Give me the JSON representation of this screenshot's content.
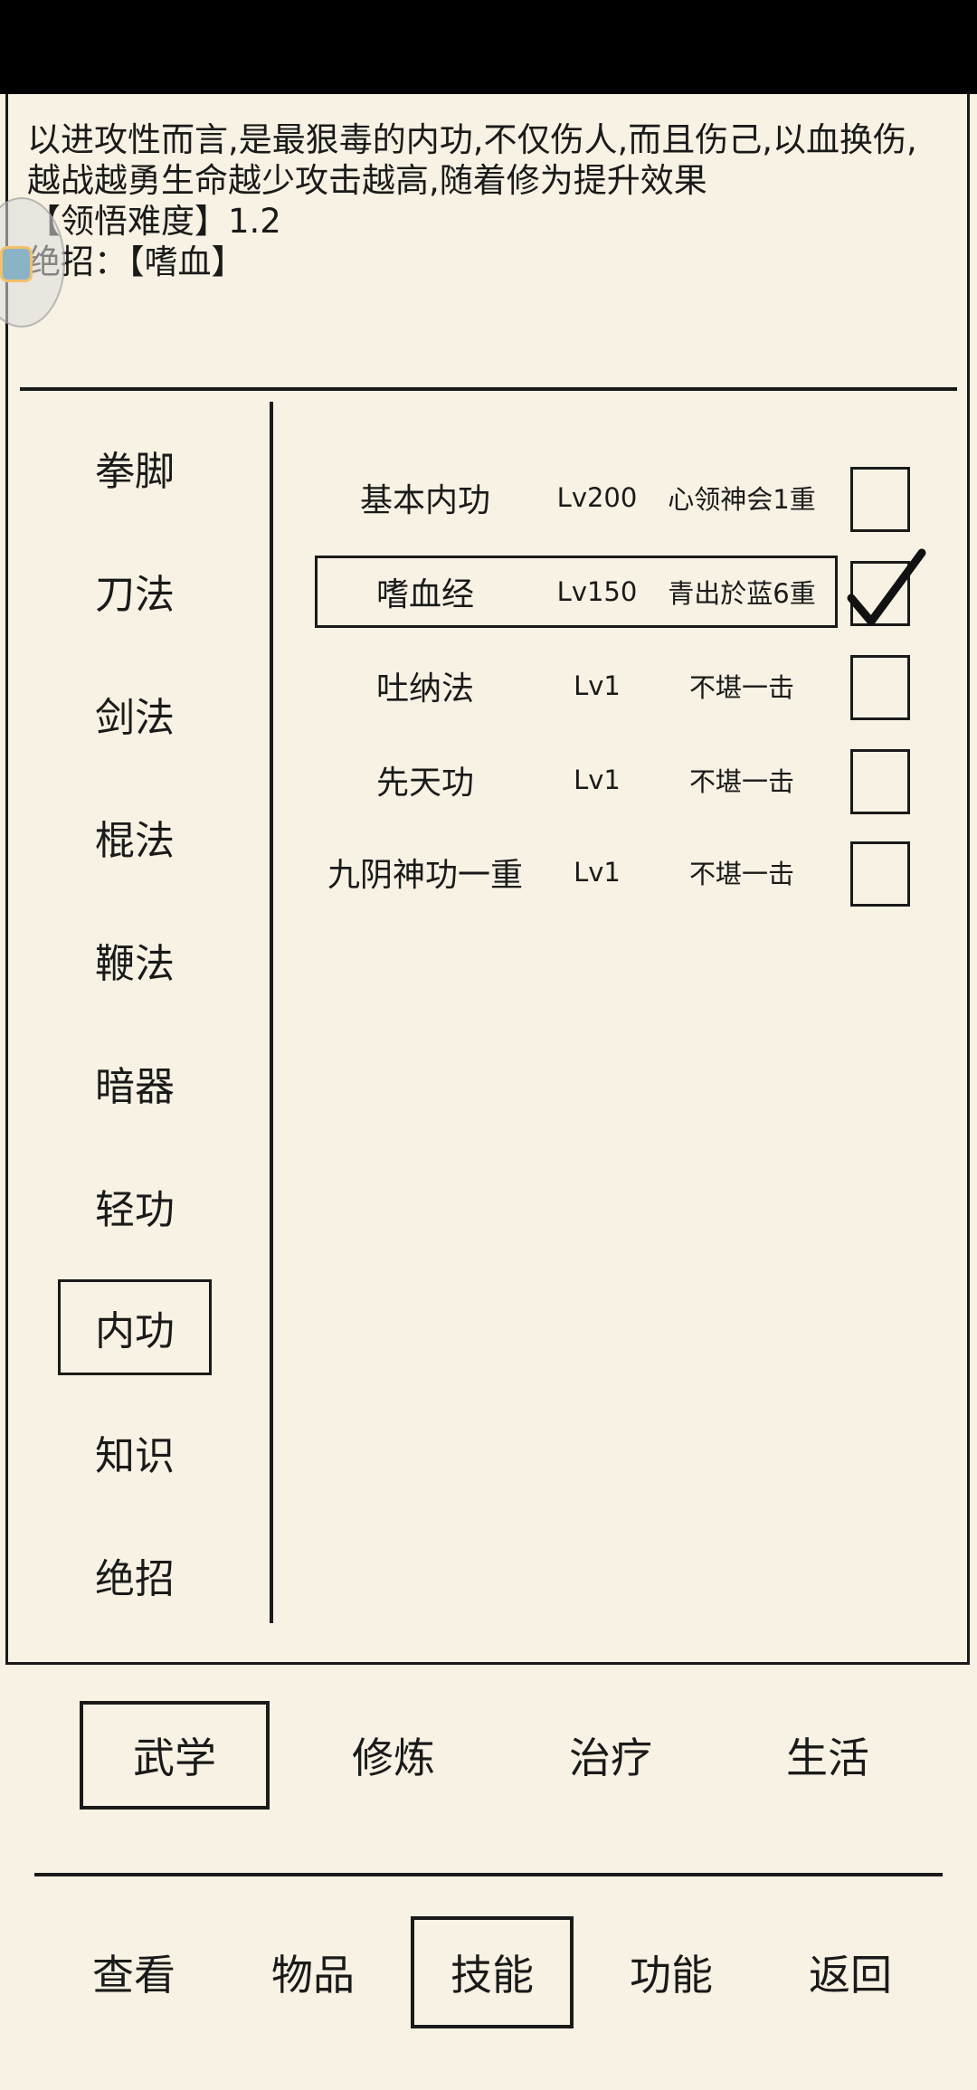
{
  "description": {
    "line1": "以进攻性而言,是最狠毒的内功,不仅伤人,而且伤己,以血换伤,",
    "line2": "越战越勇生命越少攻击越高,随着修为提升效果",
    "line3": "【领悟难度】1.2",
    "line4": "绝招：【嗜血】"
  },
  "categories": [
    "拳脚",
    "刀法",
    "剑法",
    "棍法",
    "鞭法",
    "暗器",
    "轻功",
    "内功",
    "知识",
    "绝招"
  ],
  "active_category": "内功",
  "skills": [
    {
      "name": "基本内功",
      "level": "Lv200",
      "rank": "心领神会1重",
      "checked": false
    },
    {
      "name": "嗜血经",
      "level": "Lv150",
      "rank": "青出於蓝6重",
      "checked": true
    },
    {
      "name": "吐纳法",
      "level": "Lv1",
      "rank": "不堪一击",
      "checked": false
    },
    {
      "name": "先天功",
      "level": "Lv1",
      "rank": "不堪一击",
      "checked": false
    },
    {
      "name": "九阴神功一重",
      "level": "Lv1",
      "rank": "不堪一击",
      "checked": false
    }
  ],
  "tabs": [
    "武学",
    "修炼",
    "治疗",
    "生活"
  ],
  "active_tab": "武学",
  "bottom_nav": [
    "查看",
    "物品",
    "技能",
    "功能",
    "返回"
  ],
  "active_nav": "技能",
  "icons": {
    "check": "checkmark-icon",
    "bubble": "floating-assistant-icon"
  }
}
